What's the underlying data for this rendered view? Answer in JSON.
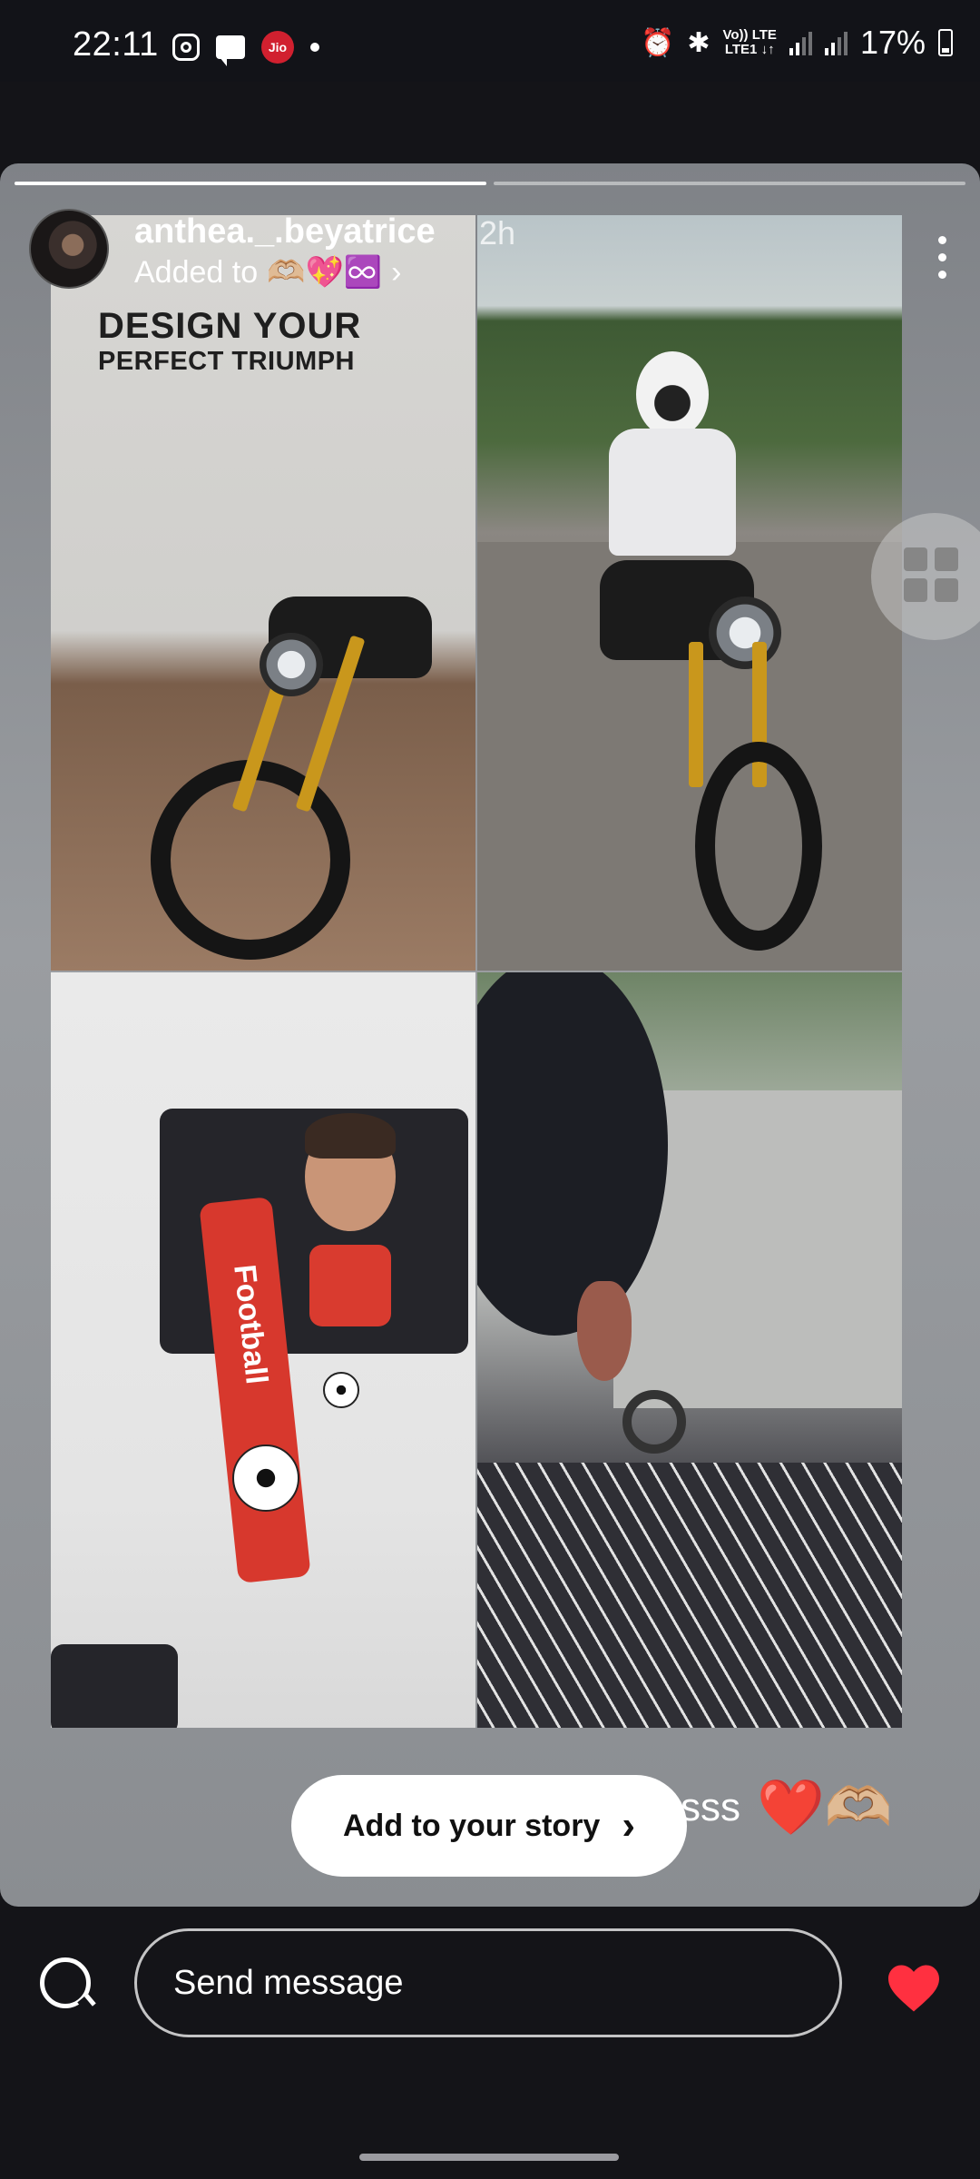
{
  "status_bar": {
    "time": "22:11",
    "net_top": "Vo)) LTE",
    "net_bottom": "LTE1 ↓↑",
    "battery": "17%"
  },
  "story": {
    "username": "anthea._.beyatrice",
    "time_ago": "2h",
    "added_to_label": "Added to",
    "added_to_emojis": "🫶🏼💖♾️",
    "poster_line1": "DESIGN YOUR",
    "poster_line2": "PERFECT TRIUMPH",
    "keychain_text": "Football",
    "caption_text": "sss",
    "caption_emojis": "❤️🫶🏼",
    "add_to_story_label": "Add to your story"
  },
  "bottom_bar": {
    "message_placeholder": "Send message"
  },
  "colors": {
    "heart": "#ff3040",
    "accent_red": "#d1202f"
  }
}
